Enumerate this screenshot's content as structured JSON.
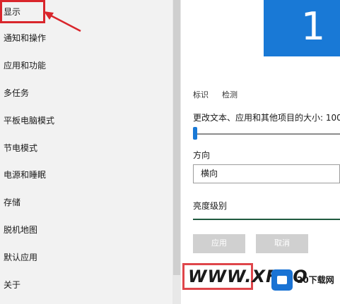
{
  "sidebar": {
    "items": [
      {
        "label": "显示"
      },
      {
        "label": "通知和操作"
      },
      {
        "label": "应用和功能"
      },
      {
        "label": "多任务"
      },
      {
        "label": "平板电脑模式"
      },
      {
        "label": "节电模式"
      },
      {
        "label": "电源和睡眠"
      },
      {
        "label": "存储"
      },
      {
        "label": "脱机地图"
      },
      {
        "label": "默认应用"
      },
      {
        "label": "关于"
      }
    ]
  },
  "monitor": {
    "number": "1"
  },
  "links": {
    "identify": "标识",
    "detect": "检测"
  },
  "scale": {
    "label": "更改文本、应用和其他项目的大小: 100",
    "value_percent": 0
  },
  "orientation": {
    "label": "方向",
    "value": "横向"
  },
  "brightness": {
    "label": "亮度级别"
  },
  "buttons": {
    "apply": "应用",
    "cancel": "取消"
  },
  "watermark": {
    "text": "WWW.XFDO",
    "site": "20下载网"
  },
  "colors": {
    "accent": "#1979d6",
    "highlight": "#d9262c"
  }
}
